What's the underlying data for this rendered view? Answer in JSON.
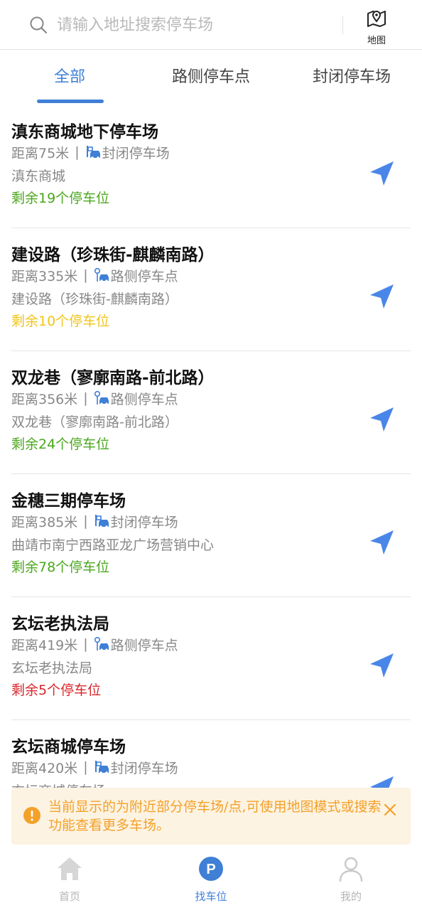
{
  "search": {
    "placeholder": "请输入地址搜索停车场"
  },
  "map_button": {
    "label": "地图"
  },
  "tabs": [
    {
      "label": "全部",
      "active": true
    },
    {
      "label": "路侧停车点",
      "active": false
    },
    {
      "label": "封闭停车场",
      "active": false
    }
  ],
  "parking_list": [
    {
      "name": "滇东商城地下停车场",
      "distance": "距离75米",
      "type": "封闭停车场",
      "type_icon": "closed-lot-icon",
      "address": "滇东商城",
      "remaining": "剩余19个停车位",
      "remaining_color": "#4aa71c"
    },
    {
      "name": "建设路（珍珠街-麒麟南路）",
      "distance": "距离335米",
      "type": "路侧停车点",
      "type_icon": "roadside-parking-icon",
      "address": "建设路（珍珠街-麒麟南路）",
      "remaining": "剩余10个停车位",
      "remaining_color": "#f0c419"
    },
    {
      "name": "双龙巷（寥廓南路-前北路）",
      "distance": "距离356米",
      "type": "路侧停车点",
      "type_icon": "roadside-parking-icon",
      "address": "双龙巷（寥廓南路-前北路）",
      "remaining": "剩余24个停车位",
      "remaining_color": "#4aa71c"
    },
    {
      "name": "金穗三期停车场",
      "distance": "距离385米",
      "type": "封闭停车场",
      "type_icon": "closed-lot-icon",
      "address": "曲靖市南宁西路亚龙广场营销中心",
      "remaining": "剩余78个停车位",
      "remaining_color": "#4aa71c"
    },
    {
      "name": "玄坛老执法局",
      "distance": "距离419米",
      "type": "路侧停车点",
      "type_icon": "roadside-parking-icon",
      "address": "玄坛老执法局",
      "remaining": "剩余5个停车位",
      "remaining_color": "#d9262c"
    },
    {
      "name": "玄坛商城停车场",
      "distance": "距离420米",
      "type": "封闭停车场",
      "type_icon": "closed-lot-icon",
      "address": "玄坛商城停车场",
      "remaining": "",
      "remaining_color": "#4aa71c"
    }
  ],
  "notice": {
    "text": "当前显示的为附近部分停车场/点,可使用地图模式或搜索功能查看更多车场。"
  },
  "bottom_nav": [
    {
      "label": "首页",
      "icon": "home-icon",
      "active": false
    },
    {
      "label": "找车位",
      "icon": "parking-icon",
      "active": true
    },
    {
      "label": "我的",
      "icon": "profile-icon",
      "active": false
    }
  ],
  "colors": {
    "accent": "#3f7fd6",
    "notice_bg": "#fdf3e2",
    "notice_text": "#f3a12a"
  }
}
